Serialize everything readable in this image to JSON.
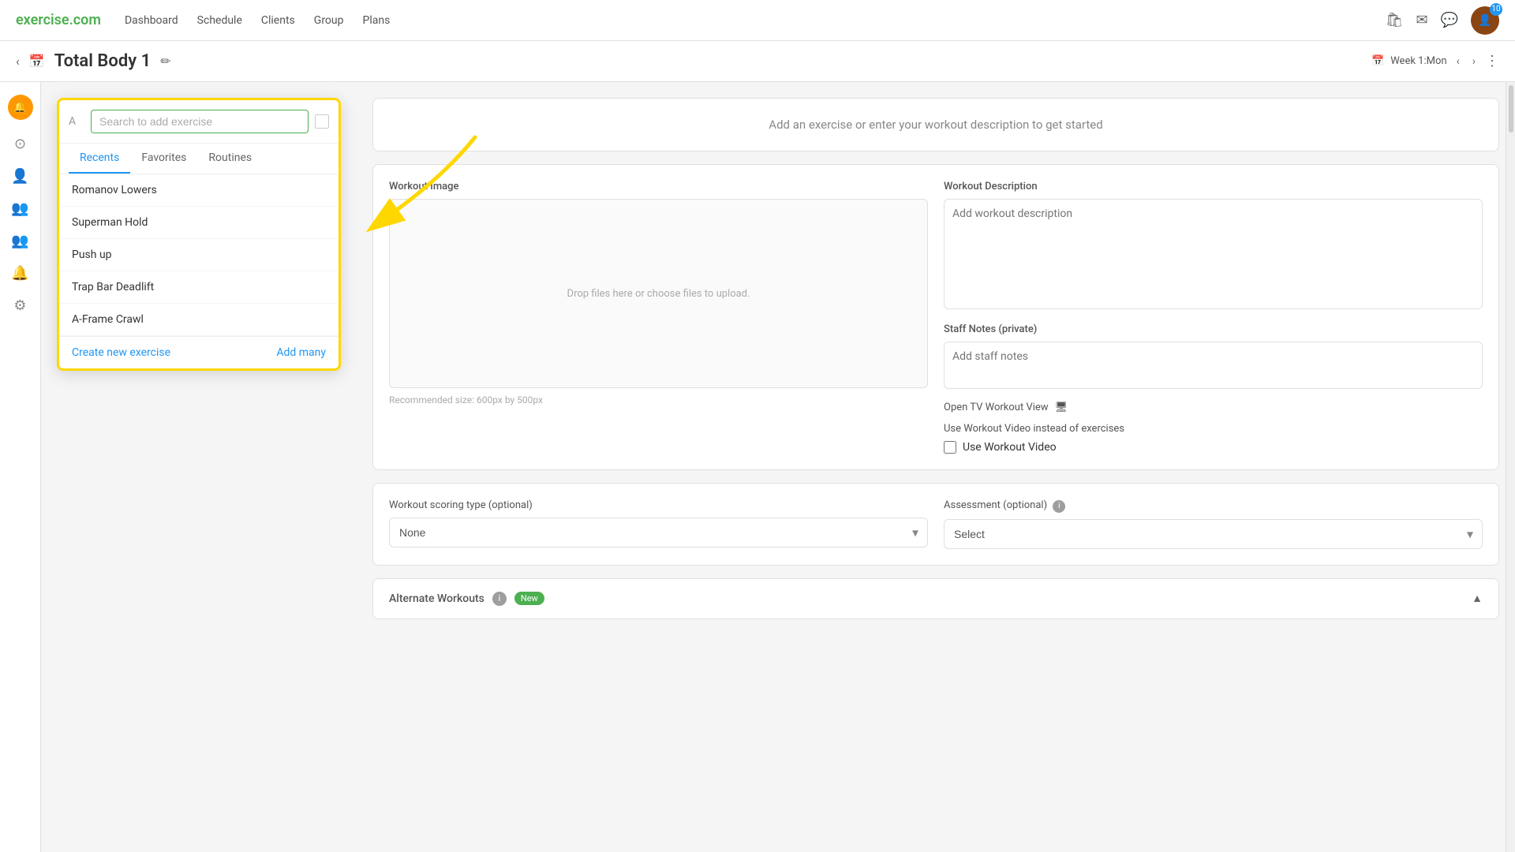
{
  "app": {
    "logo": "exercise",
    "logo_tld": ".com"
  },
  "nav": {
    "links": [
      "Dashboard",
      "Schedule",
      "Clients",
      "Group",
      "Plans"
    ]
  },
  "header": {
    "title": "Total Body 1",
    "week_label": "Week 1:Mon"
  },
  "sidebar": {
    "icons": [
      "home",
      "person",
      "people",
      "group",
      "bell",
      "settings"
    ]
  },
  "search_panel": {
    "placeholder": "Search to add exercise",
    "tabs": [
      "Recents",
      "Favorites",
      "Routines"
    ],
    "active_tab": "Recents",
    "exercises": [
      "Romanov Lowers",
      "Superman Hold",
      "Push up",
      "Trap Bar Deadlift",
      "A-Frame Crawl"
    ],
    "footer_links": {
      "create": "Create new exercise",
      "add_many": "Add many"
    }
  },
  "workout": {
    "prompt": "Add an exercise or enter your workout description to get started",
    "image_label": "Workout Image",
    "image_placeholder": "Drop files here or choose files to upload.",
    "image_size_hint": "Recommended size: 600px by 500px",
    "description_label": "Workout Description",
    "description_placeholder": "Add workout description",
    "staff_notes_label": "Staff Notes (private)",
    "staff_notes_placeholder": "Add staff notes",
    "tv_view_label": "Open TV Workout View",
    "video_section_label": "Use Workout Video instead of exercises",
    "video_checkbox_label": "Use Workout Video",
    "scoring_label": "Workout scoring type (optional)",
    "scoring_value": "None",
    "assessment_label": "Assessment (optional)",
    "assessment_value": "Select",
    "alternate_workouts_label": "Alternate Workouts",
    "new_badge": "New"
  }
}
